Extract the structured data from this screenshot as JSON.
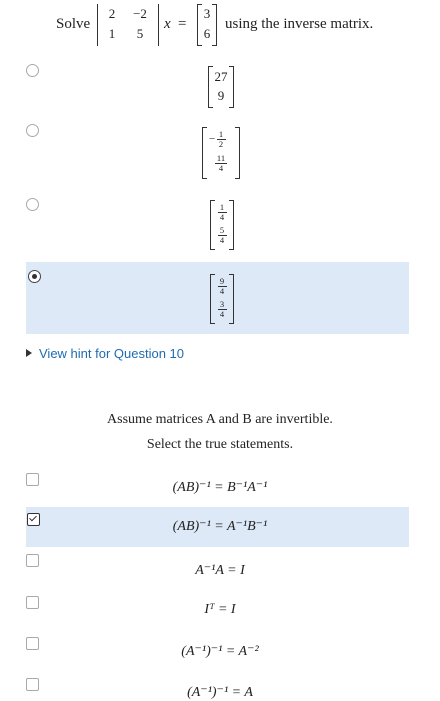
{
  "question1": {
    "solve_word": "Solve",
    "matrix": [
      [
        "2",
        "−2"
      ],
      [
        "1",
        "5"
      ]
    ],
    "xvec": "x⃗",
    "equals": "=",
    "rhs": [
      "3",
      "6"
    ],
    "suffix": "using the inverse matrix.",
    "options": [
      {
        "type": "ints",
        "top": "27",
        "bottom": "9",
        "selected": false
      },
      {
        "type": "fracs",
        "top": {
          "sign": "−",
          "n": "1",
          "d": "2"
        },
        "bottom": {
          "sign": "",
          "n": "11",
          "d": "4"
        },
        "selected": false
      },
      {
        "type": "fracs",
        "top": {
          "sign": "",
          "n": "1",
          "d": "4"
        },
        "bottom": {
          "sign": "",
          "n": "5",
          "d": "4"
        },
        "selected": false
      },
      {
        "type": "fracs",
        "top": {
          "sign": "",
          "n": "9",
          "d": "4"
        },
        "bottom": {
          "sign": "",
          "n": "3",
          "d": "4"
        },
        "selected": true
      }
    ]
  },
  "hint": {
    "label": "View hint for Question 10"
  },
  "question2": {
    "line1": "Assume matrices A and B are invertible.",
    "line2": "Select the true statements.",
    "statements": [
      {
        "text": "(AB)⁻¹ = B⁻¹A⁻¹",
        "checked": false
      },
      {
        "text": "(AB)⁻¹ = A⁻¹B⁻¹",
        "checked": true
      },
      {
        "text": "A⁻¹A = I",
        "checked": false
      },
      {
        "text": "Iᵀ = I",
        "checked": false
      },
      {
        "text": "(A⁻¹)⁻¹ = A⁻²",
        "checked": false
      },
      {
        "text": "(A⁻¹)⁻¹ = A",
        "checked": false
      }
    ]
  },
  "colors": {
    "selected_bg": "#dde9f7",
    "link": "#1f6bb0"
  }
}
